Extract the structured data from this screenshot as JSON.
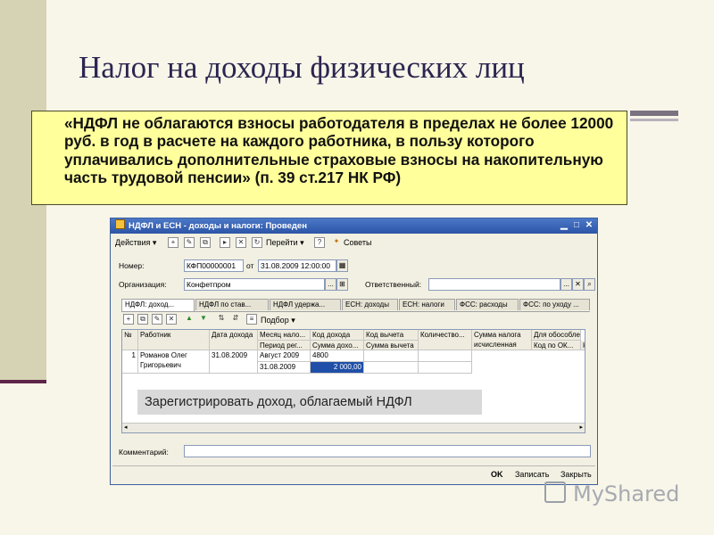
{
  "slide": {
    "title": "Налог на доходы физических лиц",
    "note": "«НДФЛ не облагаются взносы работодателя в пределах не более 12000 руб. в год в расчете на каждого работника, в пользу которого уплачивались дополнительные страховые взносы на накопительную часть трудовой пенсии» (п. 39 ст.217 НК РФ)"
  },
  "window": {
    "title": "НДФЛ и ЕСН - доходы и налоги: Проведен",
    "toolbar": {
      "actions": "Действия ▾",
      "goto": "Перейти ▾",
      "tips": "Советы",
      "podbor": "Подбор ▾"
    },
    "form": {
      "number_label": "Номер:",
      "number_value": "КФП00000001",
      "from_label": "от",
      "date_value": "31.08.2009 12:00:00",
      "org_label": "Организация:",
      "org_value": "Конфетпром",
      "responsible_label": "Ответственный:",
      "responsible_value": "",
      "comment_label": "Комментарий:",
      "comment_value": ""
    },
    "tabs": [
      "НДФЛ: доход...",
      "НДФЛ по став...",
      "НДФЛ удержа...",
      "ЕСН: доходы",
      "ЕСН: налоги",
      "ФСС: расходы",
      "ФСС: по уходу ..."
    ],
    "table": {
      "headers": {
        "num": "№",
        "employee": "Работник",
        "date": "Дата дохода",
        "month": "Месяц нало...",
        "period": "Период рег...",
        "income_code": "Код дохода",
        "income_sum": "Сумма дохо...",
        "deduction_code": "Код вычета",
        "deduction_sum": "Сумма вычета",
        "quantity": "Количество...",
        "tax_sum": "Сумма налога исчисленная",
        "separate": "Для обособле...",
        "ok_code": "Код по ОК...",
        "k": "К"
      },
      "rows": [
        {
          "num": "1",
          "employee": "Романов Олег Григорьевич",
          "date": "31.08.2009",
          "month": "Август 2009",
          "period": "31.08.2009",
          "income_code": "4800",
          "income_sum": "2 000,00"
        }
      ]
    },
    "banner": "Зарегистрировать доход, облагаемый НДФЛ",
    "buttons": {
      "ok": "OK",
      "save": "Записать",
      "close": "Закрыть"
    }
  },
  "watermark": "MyShared",
  "colors": {
    "titlebar": "#2c55a6",
    "note_bg": "#ffff9c",
    "selected_cell": "#1f4fa8"
  }
}
